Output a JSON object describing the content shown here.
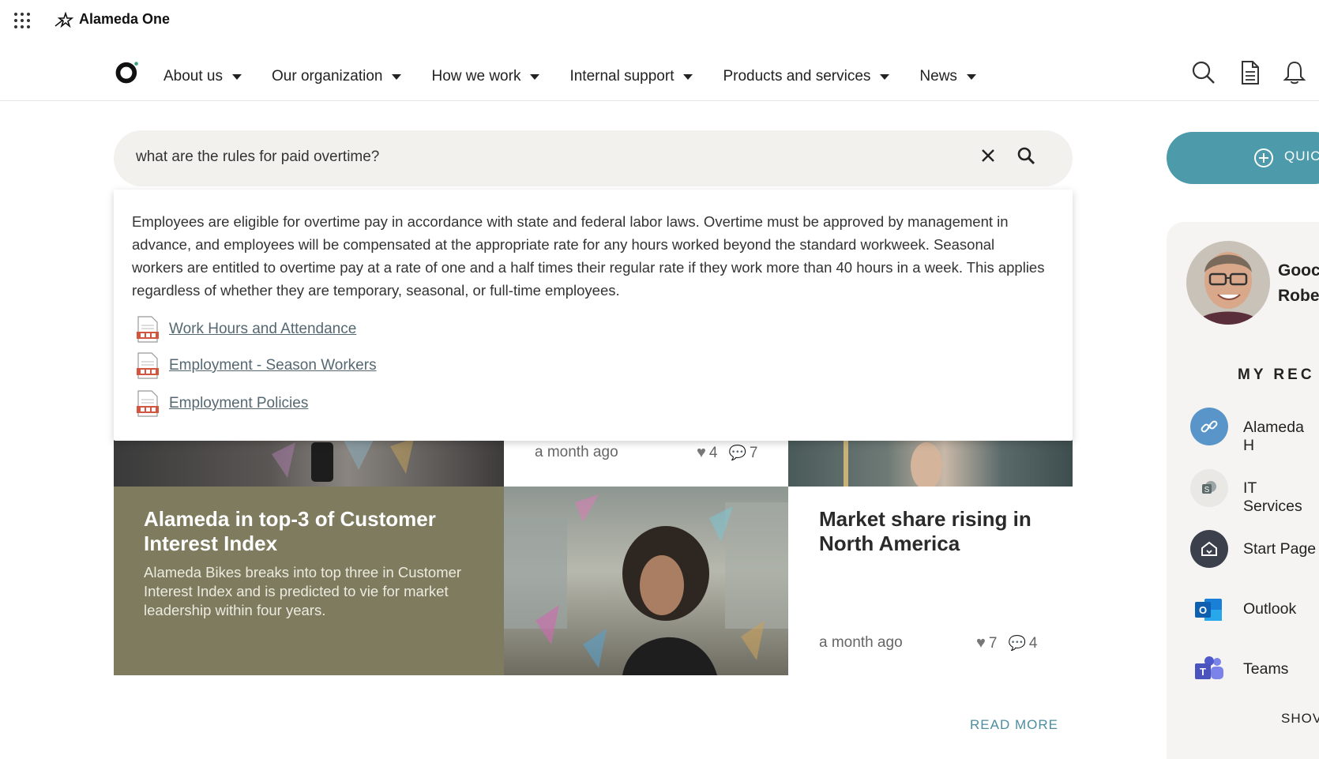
{
  "app": {
    "brand": "Alameda One"
  },
  "nav": {
    "items": [
      {
        "label": "About us"
      },
      {
        "label": "Our organization"
      },
      {
        "label": "How we work"
      },
      {
        "label": "Internal support"
      },
      {
        "label": "Products and services"
      },
      {
        "label": "News"
      }
    ]
  },
  "search": {
    "query": "what are the rules for paid overtime?",
    "answer": "Employees are eligible for overtime pay in accordance with state and federal labor laws. Overtime must be approved by management in advance, and employees will be compensated at the appropriate rate for any hours worked beyond the standard workweek. Seasonal workers are entitled to overtime pay at a rate of one and a half times their regular rate if they work more than 40 hours in a week. This applies regardless of whether they are temporary, seasonal, or full-time employees.",
    "sources": [
      {
        "label": "Work Hours and Attendance"
      },
      {
        "label": "Employment - Season Workers"
      },
      {
        "label": "Employment Policies"
      }
    ]
  },
  "news": {
    "card_top_middle": {
      "time": "a month ago",
      "likes": "4",
      "comments": "7"
    },
    "card_green": {
      "title": "Alameda in top-3 of Customer Interest Index",
      "body": "Alameda Bikes breaks into top three in Customer Interest Index and is predicted to vie for market leadership within four years."
    },
    "card_market": {
      "title": "Market share rising in North America",
      "time": "a month ago",
      "likes": "7",
      "comments": "4"
    },
    "read_more": "READ MORE"
  },
  "sidebar": {
    "quick_label": "QUIC",
    "greeting_line1": "Gooc",
    "greeting_line2": "Robe",
    "section_title": "MY REC",
    "items": [
      {
        "label": "Alameda H",
        "icon": "link-icon"
      },
      {
        "label": "IT Services",
        "icon": "sharepoint-icon"
      },
      {
        "label": "Start Page",
        "icon": "home-icon"
      },
      {
        "label": "Outlook",
        "icon": "outlook-icon"
      },
      {
        "label": "Teams",
        "icon": "teams-icon"
      }
    ],
    "show_more": "SHOV"
  },
  "colors": {
    "accent": "#4c9aaa",
    "green_card": "#7e7b5e",
    "link": "#556872"
  }
}
